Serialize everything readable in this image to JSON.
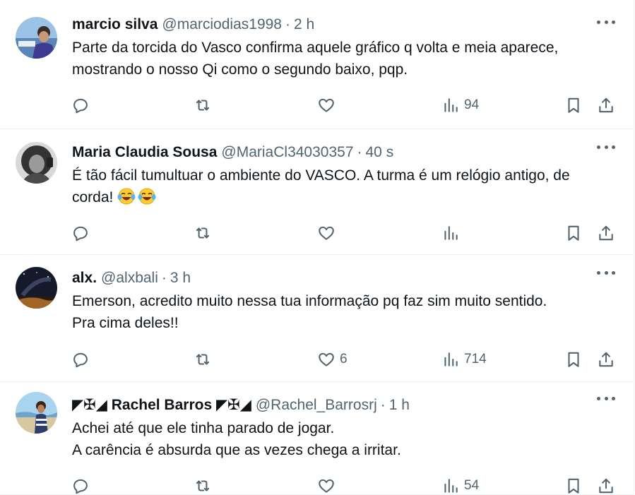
{
  "posts": [
    {
      "name": "marcio silva",
      "handle": "@marciodias1998",
      "separator": "·",
      "time": "2 h",
      "text": "Parte da torcida do Vasco confirma aquele gráfico q volta e meia aparece,\nmostrando o nosso Qi como o segundo baixo, pqp.",
      "replies": "",
      "reposts": "",
      "likes": "",
      "views": "94"
    },
    {
      "name": "Maria Claudia Sousa",
      "handle": "@MariaCl34030357",
      "separator": "·",
      "time": "40 s",
      "text": "É tão fácil tumultuar o ambiente do VASCO. A turma é um relógio antigo, de\ncorda! ",
      "replies": "",
      "reposts": "",
      "likes": "",
      "views": ""
    },
    {
      "name": "alx.",
      "handle": "@alxbali",
      "separator": "·",
      "time": "3 h",
      "text": "Emerson, acredito muito nessa tua informação pq faz sim muito sentido.\nPra cima deles!!",
      "replies": "",
      "reposts": "",
      "likes": "6",
      "views": "714"
    },
    {
      "name": "◤✠◢ Rachel Barros ◤✠◢",
      "handle": "@Rachel_Barrosrj",
      "separator": "·",
      "time": "1 h",
      "text": "Achei até que ele tinha parado de jogar.\nA carência é absurda que as vezes chega a irritar.",
      "replies": "",
      "reposts": "",
      "likes": "",
      "views": "54"
    }
  ],
  "icons": {
    "reply": "reply-icon",
    "repost": "repost-icon",
    "like": "heart-icon",
    "views": "views-icon",
    "bookmark": "bookmark-icon",
    "share": "share-icon",
    "more": "more-icon",
    "emoji": "tears-of-joy-emoji"
  },
  "colors": {
    "text": "#0f1419",
    "secondary": "#536471",
    "divider": "#eff3f4"
  }
}
